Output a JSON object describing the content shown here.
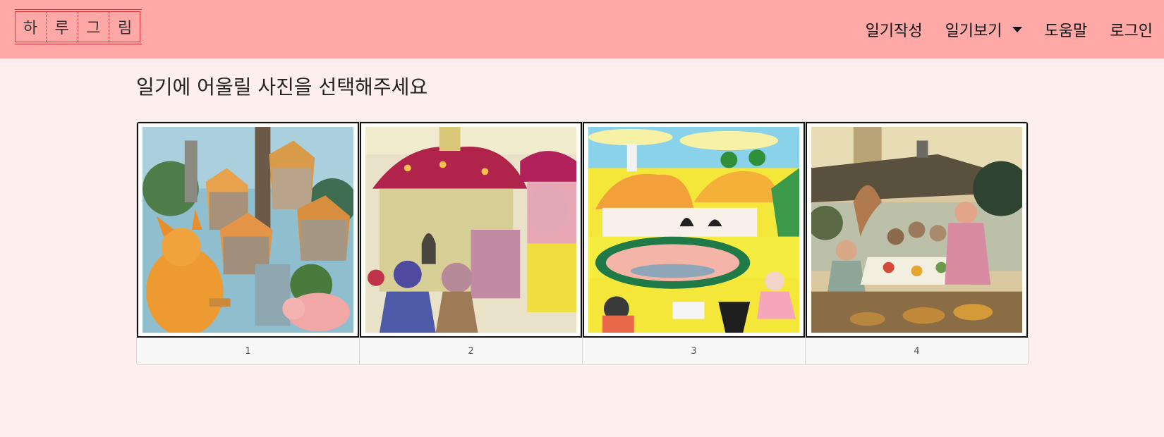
{
  "navbar": {
    "logo_chars": [
      "하",
      "루",
      "그",
      "림"
    ],
    "menu": [
      {
        "label": "일기작성"
      },
      {
        "label": "일기보기",
        "has_dropdown": true
      },
      {
        "label": "도움말"
      },
      {
        "label": "로그인"
      }
    ]
  },
  "main": {
    "title": "일기에 어울릴 사진을 선택해주세요",
    "cards": [
      {
        "label": "1",
        "image": "illustration-village-dog-pig"
      },
      {
        "label": "2",
        "image": "illustration-mushroom-house-characters"
      },
      {
        "label": "3",
        "image": "illustration-village-feast-table"
      },
      {
        "label": "4",
        "image": "illustration-house-gathering-party"
      }
    ]
  },
  "colors": {
    "navbar_bg": "#ffa8a8",
    "page_bg": "#ffeeee",
    "logo_border": "#e2343c"
  }
}
